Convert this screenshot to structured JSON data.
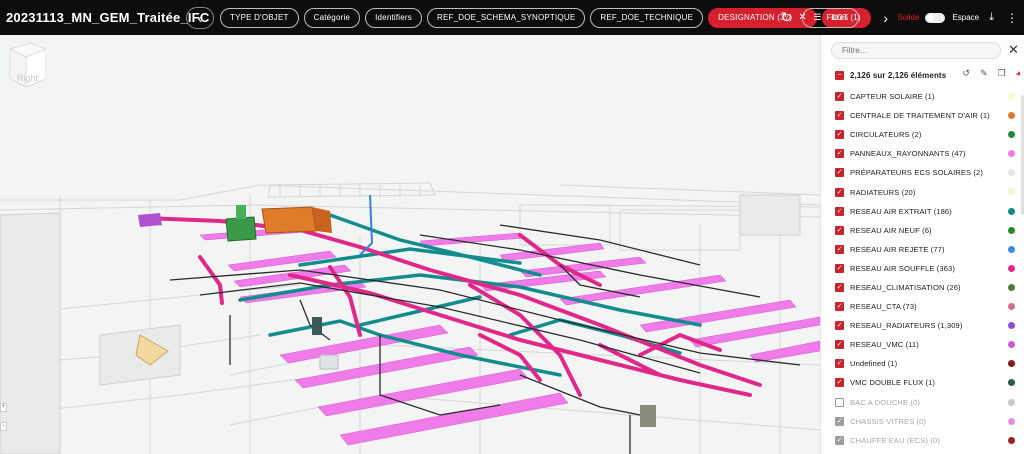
{
  "header": {
    "title": "20231113_MN_GEM_Traitée_IFC",
    "chips": [
      {
        "label": "TYPE D'OBJET",
        "active": false
      },
      {
        "label": "Catégorie",
        "active": false
      },
      {
        "label": "Identifiers",
        "active": false
      },
      {
        "label": "REF_DOE_SCHEMA_SYNOPTIQUE",
        "active": false
      },
      {
        "label": "REF_DOE_TECHNIQUE",
        "active": false
      },
      {
        "label": "DESIGNATION (37)",
        "active": true
      },
      {
        "label": "LOT (1)",
        "active": true
      }
    ],
    "filters_label": "Filtres",
    "solid_label": "Solide",
    "space_label": "Espace"
  },
  "viewer": {
    "viewcube_label": "Right"
  },
  "panel": {
    "search_placeholder": "Filtre...",
    "summary": "2,126 sur 2,126 éléments",
    "items": [
      {
        "label": "CAPTEUR SOLAIRE (1)",
        "color": "#fdf7c9",
        "checked": true
      },
      {
        "label": "CENTRALE DE TRAITEMENT D'AIR (1)",
        "color": "#e07b2a",
        "checked": true
      },
      {
        "label": "CIRCULATEURS (2)",
        "color": "#1e8a3a",
        "checked": true
      },
      {
        "label": "PANNEAUX_RAYONNANTS (47)",
        "color": "#ef7be6",
        "checked": true
      },
      {
        "label": "PRÉPARATEURS ECS SOLAIRES (2)",
        "color": "#e3e6ef",
        "checked": true
      },
      {
        "label": "RADIATEURS (20)",
        "color": "#fbf0d2",
        "checked": true
      },
      {
        "label": "RESEAU AIR EXTRAIT (186)",
        "color": "#138a8a",
        "checked": true
      },
      {
        "label": "RESEAU AIR NEUF (6)",
        "color": "#2a8a2a",
        "checked": true
      },
      {
        "label": "RESEAU AIR REJETE (77)",
        "color": "#3b8be0",
        "checked": true
      },
      {
        "label": "RESEAU AIR SOUFFLE (363)",
        "color": "#e0288a",
        "checked": true
      },
      {
        "label": "RESEAU_CLIMATISATION (26)",
        "color": "#4e7a3a",
        "checked": true
      },
      {
        "label": "RESEAU_CTA (73)",
        "color": "#d86a8a",
        "checked": true
      },
      {
        "label": "RESEAU_RADIATEURS (1,309)",
        "color": "#8a4fd6",
        "checked": true
      },
      {
        "label": "RESEAU_VMC (11)",
        "color": "#c95ad0",
        "checked": true
      },
      {
        "label": "Undefined (1)",
        "color": "#8a1a1a",
        "checked": true
      },
      {
        "label": "VMC DOUBLE FLUX (1)",
        "color": "#2a5a5a",
        "checked": true
      },
      {
        "label": "BAC A DOUCHE (0)",
        "color": "#c8c8c8",
        "checked": false
      },
      {
        "label": "CHASSIS VITRES (0)",
        "color": "#e98ae0",
        "checked": "partial"
      },
      {
        "label": "CHAUFFE EAU (ECS) (0)",
        "color": "#a32020",
        "checked": "partial"
      }
    ]
  }
}
